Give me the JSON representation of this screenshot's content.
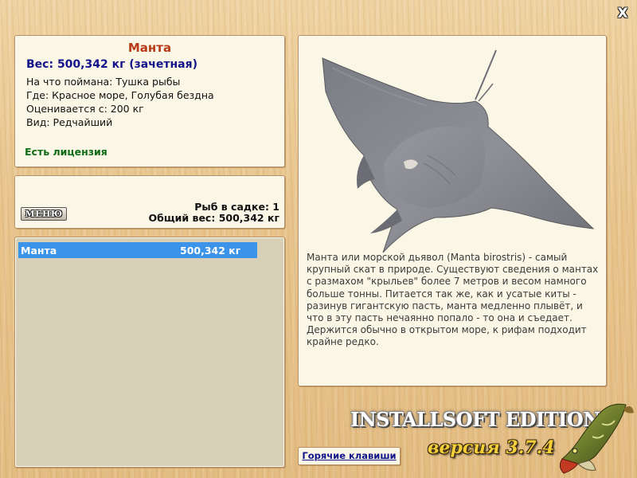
{
  "window": {
    "close_label": "X"
  },
  "fish": {
    "name": "Манта",
    "weight_line": "Вес: 500,342 кг (зачетная)",
    "caught_on": "На что поймана: Тушка рыбы",
    "location": "Где: Красное море, Голубая бездна",
    "price": "Оценивается с: 200 кг",
    "kind": "Вид: Редчайший",
    "license": "Есть лицензия"
  },
  "keep": {
    "menu_label": "МЕНЮ",
    "count_line": "Рыб в садке: 1",
    "total_line": "Общий вес: 500,342 кг"
  },
  "catch_list": [
    {
      "name": "Манта",
      "weight": "500,342 кг"
    }
  ],
  "detail": {
    "image": "manta-ray-image",
    "description": "Манта или морской дьявол (Manta birostris) - самый крупный скат в природе. Существуют сведения о мантах с размахом \"крыльев\" более 7 метров и весом намного больше тонны. Питается так же, как и усатые киты - разинув гигантскую пасть, манта медленно плывёт, и что в эту пасть нечаянно попало - то она и съедает. Держится обычно в открытом море, к рифам подходит крайне редко."
  },
  "footer": {
    "hotkeys_label": "Горячие клавиши",
    "logo_title": "INSTALLSOFT EDITION",
    "logo_version": "версия 3.7.4"
  },
  "colors": {
    "fish_name": "#b83a16",
    "weight": "#13138a",
    "license": "#0f6b16",
    "selected_row": "#3b94ea",
    "panel_bg": "#fbf7e6"
  }
}
